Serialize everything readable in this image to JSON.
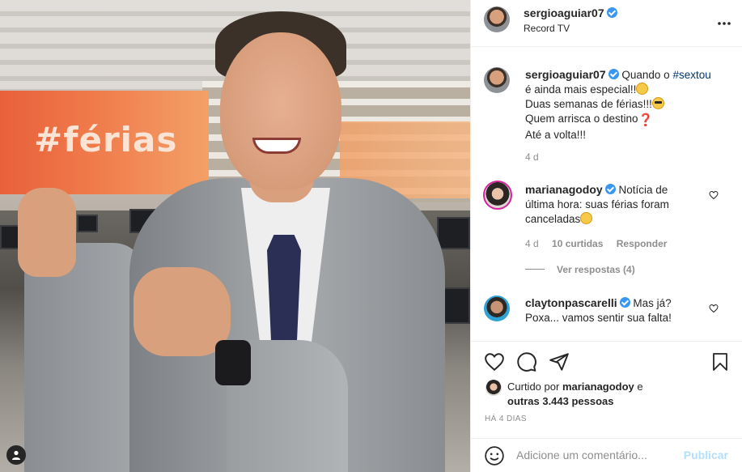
{
  "photo": {
    "banner_text": "#férias"
  },
  "post": {
    "author": "sergioaguiar07",
    "location": "Record TV",
    "more_icon": "more-horizontal-icon"
  },
  "caption": {
    "author": "sergioaguiar07",
    "lines": [
      "Quando o ",
      "#sextou",
      "é ainda mais especial!!",
      "Duas semanas de férias!!!",
      "Quem arrisca o destino",
      "Até a volta!!!"
    ],
    "time": "4 d"
  },
  "comments": [
    {
      "author": "marianagodoy",
      "text_lines": [
        "Notícia de",
        "última hora: suas férias foram",
        "canceladas"
      ],
      "time": "4 d",
      "likes": "10 curtidas",
      "reply": "Responder",
      "view_replies": "Ver respostas (4)"
    },
    {
      "author": "claytonpascarelli",
      "text_lines": [
        "Mas já?",
        "Poxa... vamos sentir sua falta!"
      ]
    }
  ],
  "actions": {
    "like_icon": "heart-icon",
    "comment_icon": "comment-icon",
    "share_icon": "share-icon",
    "save_icon": "bookmark-icon"
  },
  "likes": {
    "prefix": "Curtido por",
    "user": "marianagodoy",
    "conj": "e",
    "others": "outras 3.443 pessoas"
  },
  "date": "HÁ 4 DIAS",
  "add_comment": {
    "placeholder": "Adicione um comentário...",
    "publish": "Publicar",
    "emoji_icon": "emoji-icon"
  },
  "colors": {
    "verified": "#3897f0",
    "link": "#00376b",
    "publish_disabled": "#b2dffc"
  }
}
